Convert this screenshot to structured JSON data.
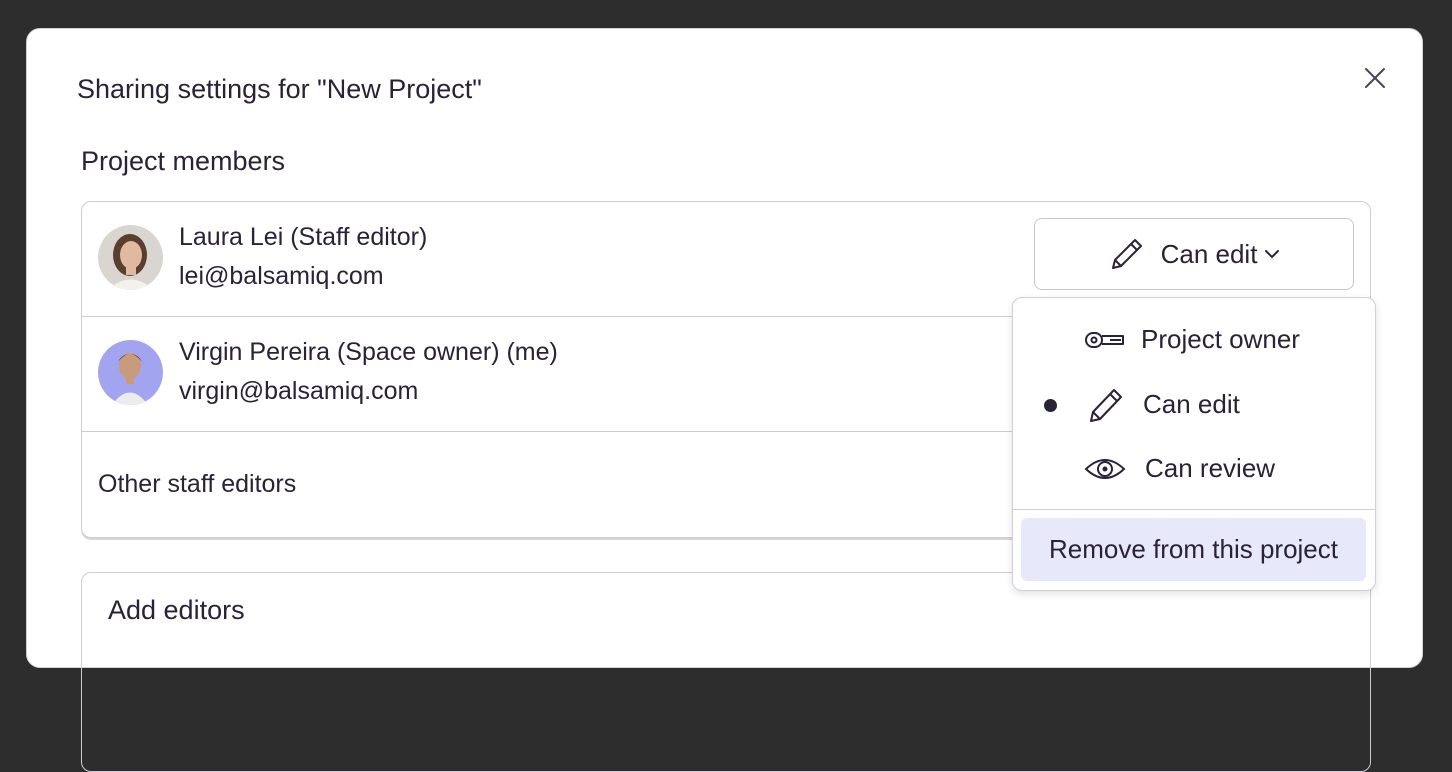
{
  "dialog": {
    "title": "Sharing settings for \"New Project\"",
    "close_icon": "close-icon"
  },
  "members_section": {
    "title": "Project members",
    "members": [
      {
        "name": "Laura Lei (Staff editor)",
        "email": "lei@balsamiq.com",
        "permission": "Can edit"
      },
      {
        "name": "Virgin Pereira (Space owner) (me)",
        "email": "virgin@balsamiq.com"
      }
    ],
    "other_label": "Other staff editors"
  },
  "permission_menu": {
    "items": [
      {
        "label": "Project owner",
        "icon": "key-icon",
        "selected": false
      },
      {
        "label": "Can edit",
        "icon": "pencil-icon",
        "selected": true
      },
      {
        "label": "Can review",
        "icon": "eye-icon",
        "selected": false
      }
    ],
    "remove_label": "Remove from this project"
  },
  "add_section": {
    "title": "Add editors"
  },
  "colors": {
    "background": "#2d2d2d",
    "text": "#2a2236",
    "highlight": "#e8e8fb"
  }
}
